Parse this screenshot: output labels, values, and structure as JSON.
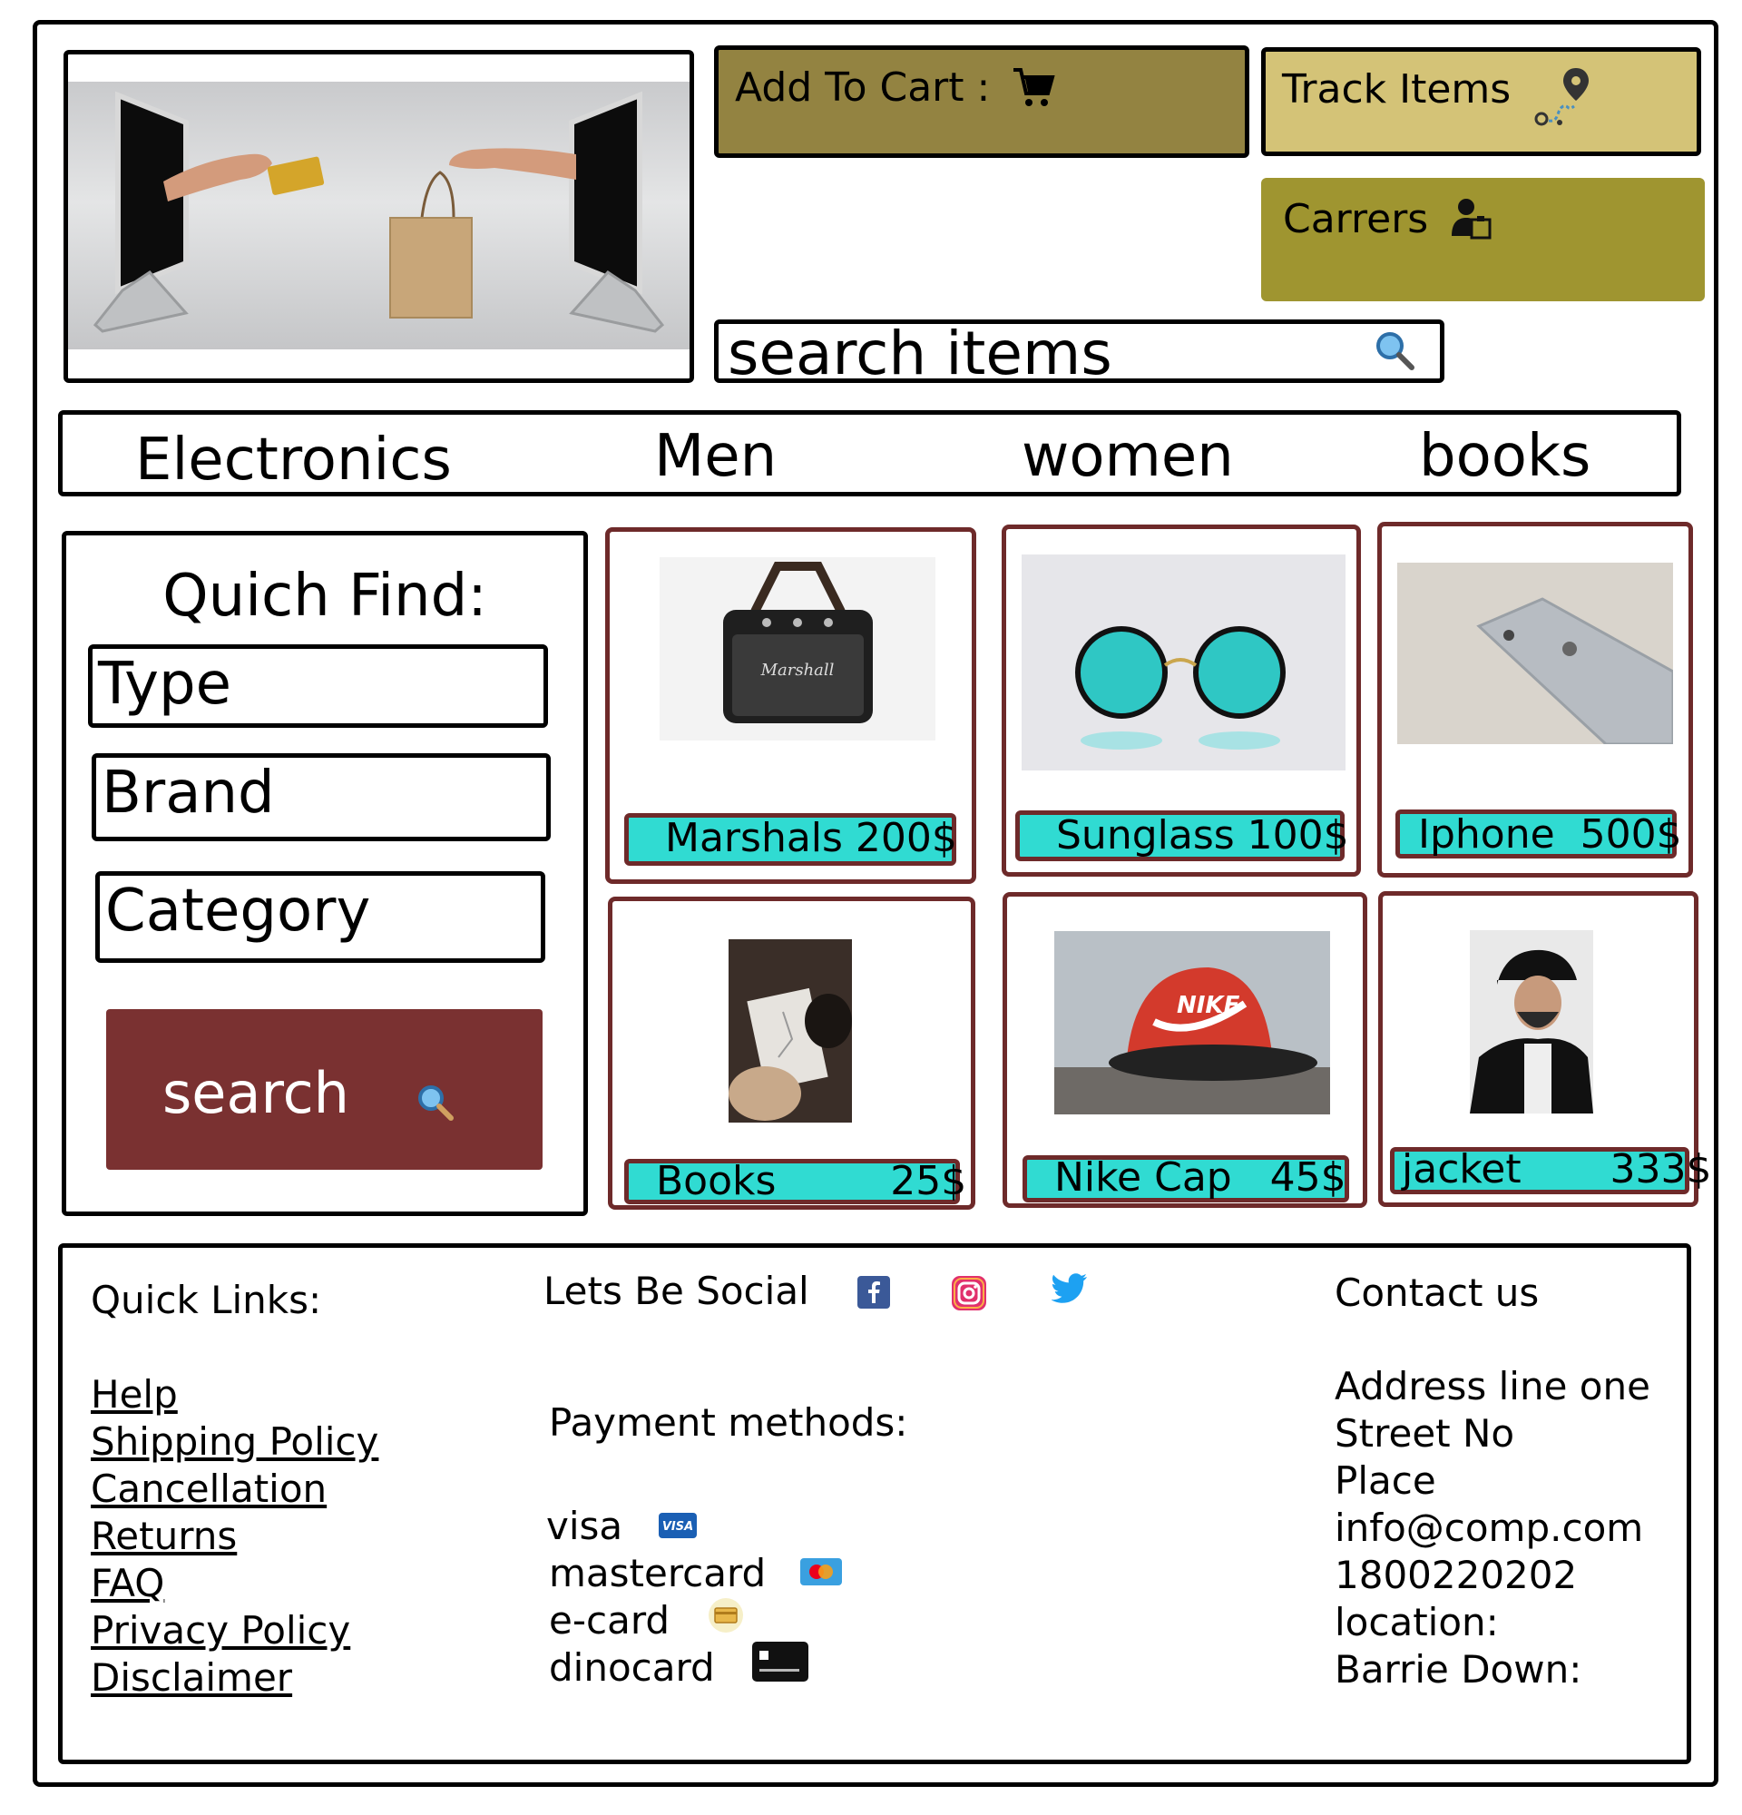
{
  "header": {
    "add_to_cart": "Add To Cart :",
    "track_items": "Track Items",
    "careers": "Carrers",
    "search_placeholder": "search items"
  },
  "categories": [
    "Electronics",
    "Men",
    "women",
    "books"
  ],
  "quick_find": {
    "title": "Quich Find:",
    "fields": [
      "Type",
      "Brand",
      "Category"
    ],
    "search_label": "search"
  },
  "products": [
    {
      "label": "Marshals 200$",
      "image": "marshall speaker"
    },
    {
      "label": "Sunglass 100$",
      "image": "round sunglasses"
    },
    {
      "label": "Iphone  500$",
      "image": "iphone"
    },
    {
      "label": "Books         25$",
      "image": "book"
    },
    {
      "label": "Nike Cap   45$",
      "image": "nike cap"
    },
    {
      "label": "jacket       333$",
      "image": "man in jacket"
    }
  ],
  "footer": {
    "quick_links_title": "Quick Links:",
    "links": [
      "Help",
      "Shipping Policy",
      "Cancellation",
      "Returns",
      "FAQ",
      "Privacy Policy",
      "Disclaimer"
    ],
    "social_title": "Lets Be Social",
    "social_icons": [
      "facebook-icon",
      "instagram-icon",
      "twitter-icon"
    ],
    "payment_title": "Payment methods:",
    "payments": [
      "visa",
      "mastercard",
      "e-card",
      "dinocard"
    ],
    "contact_title": "Contact us",
    "contact_lines": [
      "Address line one",
      "Street No",
      "Place",
      "info@comp.com",
      "1800220202",
      "location:",
      "Barrie Down:"
    ]
  },
  "colors": {
    "cart": "#938341",
    "track": "#d4c377",
    "careers": "#9f9530",
    "search_button": "#7a3131",
    "price_tag": "#30dbd2",
    "card_border": "#6e2a2a"
  }
}
